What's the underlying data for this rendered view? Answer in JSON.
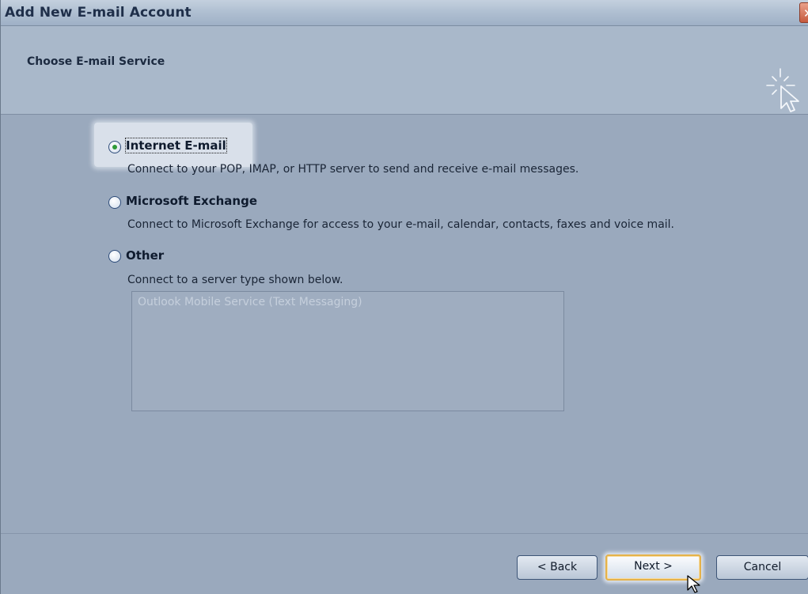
{
  "window": {
    "title": "Add New E-mail Account",
    "close_glyph": "✕"
  },
  "header": {
    "title": "Choose E-mail Service",
    "icon": "mouse-pointer-sparkle-icon"
  },
  "options": [
    {
      "label": "Internet E-mail",
      "description": "Connect to your POP, IMAP, or HTTP server to send and receive e-mail messages.",
      "selected": true
    },
    {
      "label": "Microsoft Exchange",
      "description": "Connect to Microsoft Exchange for access to your e-mail, calendar, contacts, faxes and voice mail.",
      "selected": false
    },
    {
      "label": "Other",
      "description": "Connect to a server type shown below.",
      "selected": false
    }
  ],
  "server_list": {
    "items": [
      "Outlook Mobile Service (Text Messaging)"
    ]
  },
  "buttons": {
    "back": "< Back",
    "next": "Next >",
    "cancel": "Cancel"
  },
  "colors": {
    "dialog_bg": "#9aa9bd",
    "header_bg": "#a9b8ca",
    "default_button_border": "#e5b24a",
    "radio_dot": "#2f9a38"
  }
}
